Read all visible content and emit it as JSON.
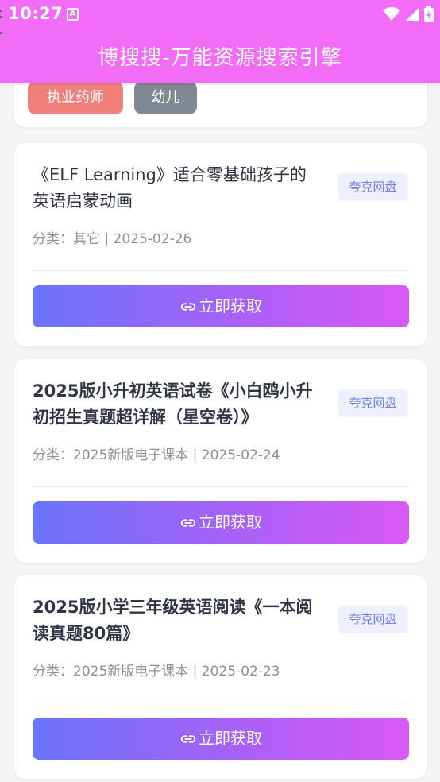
{
  "status_bar": {
    "time": "10:27",
    "notification_letter": "A"
  },
  "app": {
    "title": "博搜搜-万能资源搜索引擎"
  },
  "tags": [
    {
      "label": "执业药师",
      "color": "#f07f7a"
    },
    {
      "label": "幼儿",
      "color": "#808993"
    }
  ],
  "results": [
    {
      "title": "《ELF Learning》适合零基础孩子的英语启蒙动画",
      "source": "夸克网盘",
      "meta": "分类：其它 | 2025-02-26",
      "button_label": "立即获取"
    },
    {
      "title": "2025版小升初英语试卷《小白鸥小升初招生真题超详解（星空卷）》",
      "source": "夸克网盘",
      "meta": "分类：2025新版电子课本 | 2025-02-24",
      "button_label": "立即获取"
    },
    {
      "title": "2025版小学三年级英语阅读《一本阅读真题80篇》",
      "source": "夸克网盘",
      "meta": "分类：2025新版电子课本 | 2025-02-23",
      "button_label": "立即获取"
    }
  ],
  "colors": {
    "header": "#f26cf7",
    "badge_text": "#6c7ee8",
    "button_gradient_start": "#6a74fb",
    "button_gradient_end": "#d958f5"
  },
  "icons": {
    "wifi": "wifi-icon",
    "signal": "signal-icon",
    "battery": "battery-icon",
    "link": "link-icon"
  }
}
